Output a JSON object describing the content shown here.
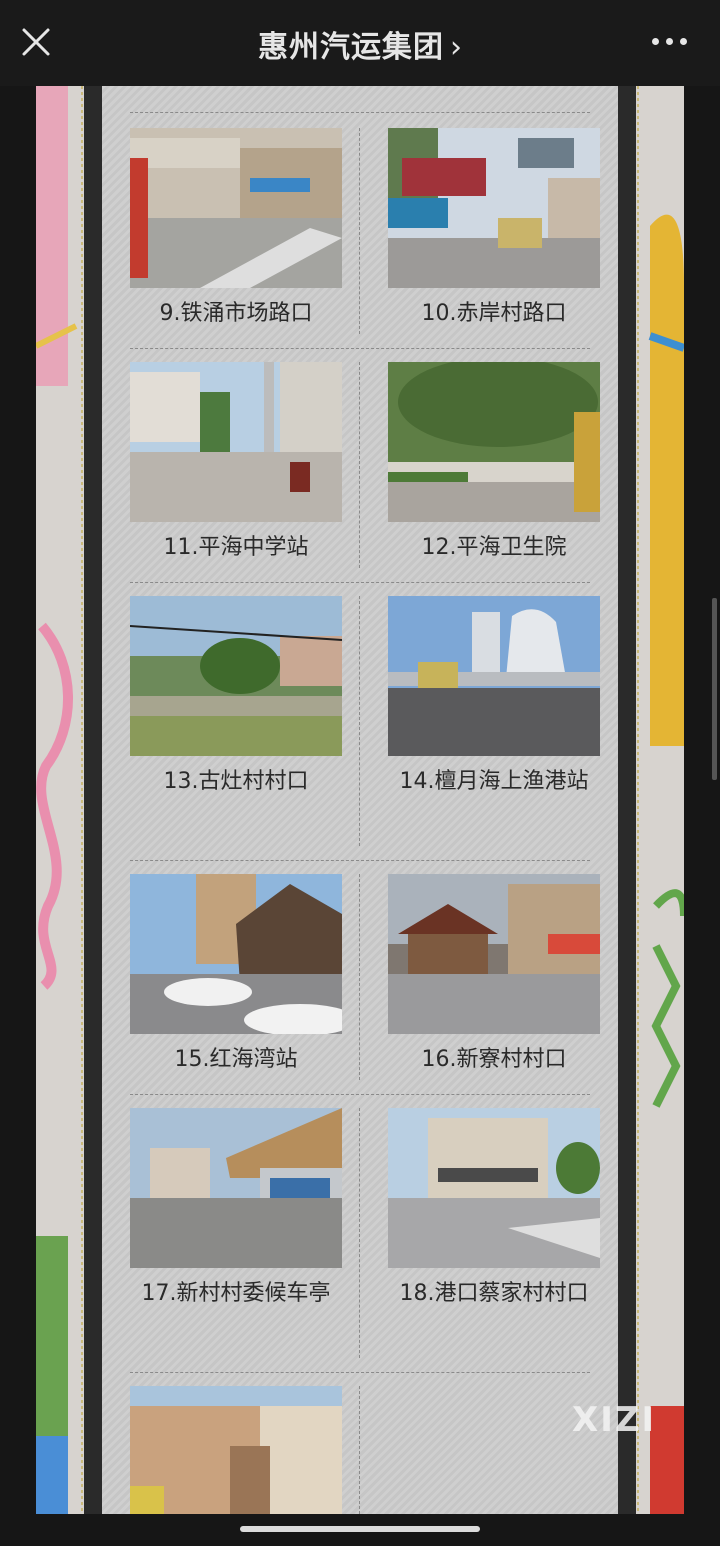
{
  "header": {
    "title": "惠州汽运集团",
    "chevron": "›",
    "close_icon": "close-icon",
    "more_icon": "more-icon"
  },
  "stations": [
    {
      "label": "9.铁涌市场路口"
    },
    {
      "label": "10.赤岸村路口"
    },
    {
      "label": "11.平海中学站"
    },
    {
      "label": "12.平海卫生院"
    },
    {
      "label": "13.古灶村村口"
    },
    {
      "label": "14.檀月海上渔港站"
    },
    {
      "label": "15.红海湾站"
    },
    {
      "label": "16.新寮村村口"
    },
    {
      "label": "17.新村村委候车亭"
    },
    {
      "label": "18.港口蔡家村村口"
    },
    {
      "label": ""
    }
  ],
  "watermark": "XIZI",
  "colors": {
    "topbar_bg": "#1a1a1a",
    "panel_bg": "#cfcfcf",
    "caption_text": "#2a2a2a"
  }
}
